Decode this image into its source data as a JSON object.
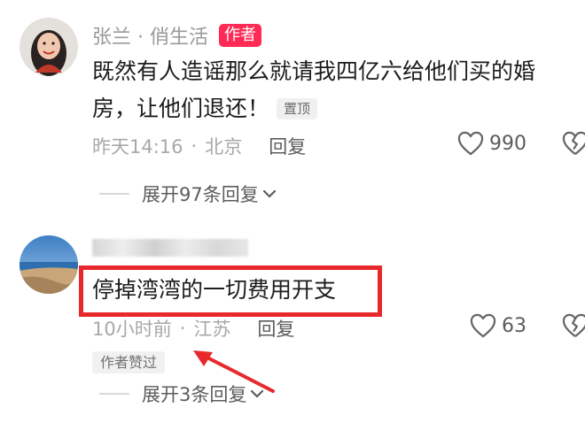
{
  "comment1": {
    "username": "张兰 · 俏生活",
    "author_badge": "作者",
    "content": "既然有人造谣那么就请我四亿六给他们买的婚房，让他们退还！",
    "pinned_badge": "置顶",
    "time": "昨天14:16",
    "location": "北京",
    "reply_label": "回复",
    "likes": "990",
    "expand_replies": "展开97条回复"
  },
  "comment2": {
    "content": "停掉湾湾的一切费用开支",
    "time": "10小时前",
    "location": "江苏",
    "reply_label": "回复",
    "likes": "63",
    "author_liked_badge": "作者赞过",
    "expand_replies": "展开3条回复"
  },
  "colors": {
    "author_badge": "#ff2b55",
    "highlight_box": "#e8292b",
    "annotation_arrow": "#e8292b"
  },
  "icons": [
    "heart-outline-icon",
    "broken-heart-icon",
    "chevron-down-icon"
  ]
}
